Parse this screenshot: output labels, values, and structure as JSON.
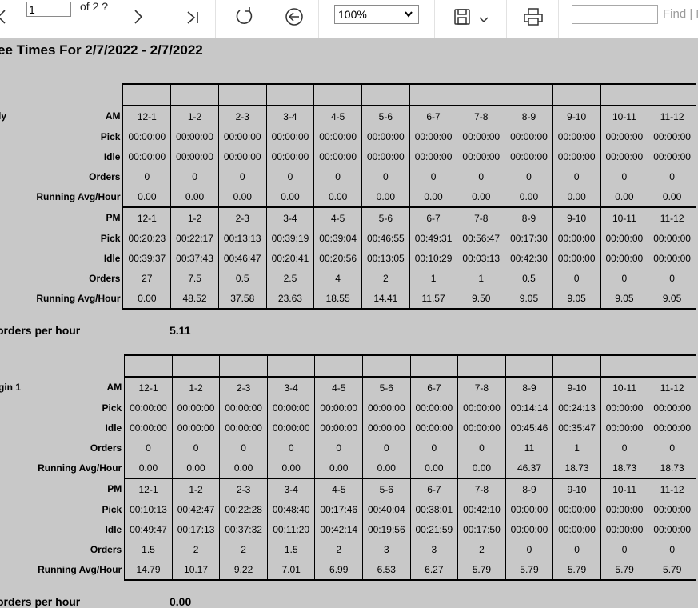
{
  "toolbar": {
    "page_value": "1",
    "page_of": "of 2 ?",
    "zoom": "100%",
    "find_value": "",
    "find_label": "Find | N"
  },
  "report": {
    "title": "ee Times For 2/7/2022 - 2/7/2022",
    "hours": [
      "12-1",
      "1-2",
      "2-3",
      "3-4",
      "4-5",
      "5-6",
      "6-7",
      "7-8",
      "8-9",
      "9-10",
      "10-11",
      "11-12"
    ],
    "row_labels": {
      "am": "AM",
      "pm": "PM",
      "pick": "Pick",
      "idle": "Idle",
      "orders": "Orders",
      "running": "Running Avg/Hour"
    },
    "sections": [
      {
        "name": "ly",
        "am": {
          "pick": [
            "00:00:00",
            "00:00:00",
            "00:00:00",
            "00:00:00",
            "00:00:00",
            "00:00:00",
            "00:00:00",
            "00:00:00",
            "00:00:00",
            "00:00:00",
            "00:00:00",
            "00:00:00"
          ],
          "idle": [
            "00:00:00",
            "00:00:00",
            "00:00:00",
            "00:00:00",
            "00:00:00",
            "00:00:00",
            "00:00:00",
            "00:00:00",
            "00:00:00",
            "00:00:00",
            "00:00:00",
            "00:00:00"
          ],
          "orders": [
            "0",
            "0",
            "0",
            "0",
            "0",
            "0",
            "0",
            "0",
            "0",
            "0",
            "0",
            "0"
          ],
          "running": [
            "0.00",
            "0.00",
            "0.00",
            "0.00",
            "0.00",
            "0.00",
            "0.00",
            "0.00",
            "0.00",
            "0.00",
            "0.00",
            "0.00"
          ]
        },
        "pm": {
          "pick": [
            "00:20:23",
            "00:22:17",
            "00:13:13",
            "00:39:19",
            "00:39:04",
            "00:46:55",
            "00:49:31",
            "00:56:47",
            "00:17:30",
            "00:00:00",
            "00:00:00",
            "00:00:00"
          ],
          "idle": [
            "00:39:37",
            "00:37:43",
            "00:46:47",
            "00:20:41",
            "00:20:56",
            "00:13:05",
            "00:10:29",
            "00:03:13",
            "00:42:30",
            "00:00:00",
            "00:00:00",
            "00:00:00"
          ],
          "orders": [
            "27",
            "7.5",
            "0.5",
            "2.5",
            "4",
            "2",
            "1",
            "1",
            "0.5",
            "0",
            "0",
            "0"
          ],
          "running": [
            "0.00",
            "48.52",
            "37.58",
            "23.63",
            "18.55",
            "14.41",
            "11.57",
            "9.50",
            "9.05",
            "9.05",
            "9.05",
            "9.05"
          ]
        },
        "summary_label": "orders per hour",
        "summary_value": "5.11"
      },
      {
        "name": "gin 1",
        "am": {
          "pick": [
            "00:00:00",
            "00:00:00",
            "00:00:00",
            "00:00:00",
            "00:00:00",
            "00:00:00",
            "00:00:00",
            "00:00:00",
            "00:14:14",
            "00:24:13",
            "00:00:00",
            "00:00:00"
          ],
          "idle": [
            "00:00:00",
            "00:00:00",
            "00:00:00",
            "00:00:00",
            "00:00:00",
            "00:00:00",
            "00:00:00",
            "00:00:00",
            "00:45:46",
            "00:35:47",
            "00:00:00",
            "00:00:00"
          ],
          "orders": [
            "0",
            "0",
            "0",
            "0",
            "0",
            "0",
            "0",
            "0",
            "11",
            "1",
            "0",
            "0"
          ],
          "running": [
            "0.00",
            "0.00",
            "0.00",
            "0.00",
            "0.00",
            "0.00",
            "0.00",
            "0.00",
            "46.37",
            "18.73",
            "18.73",
            "18.73"
          ]
        },
        "pm": {
          "pick": [
            "00:10:13",
            "00:42:47",
            "00:22:28",
            "00:48:40",
            "00:17:46",
            "00:40:04",
            "00:38:01",
            "00:42:10",
            "00:00:00",
            "00:00:00",
            "00:00:00",
            "00:00:00"
          ],
          "idle": [
            "00:49:47",
            "00:17:13",
            "00:37:32",
            "00:11:20",
            "00:42:14",
            "00:19:56",
            "00:21:59",
            "00:17:50",
            "00:00:00",
            "00:00:00",
            "00:00:00",
            "00:00:00"
          ],
          "orders": [
            "1.5",
            "2",
            "2",
            "1.5",
            "2",
            "3",
            "3",
            "2",
            "0",
            "0",
            "0",
            "0"
          ],
          "running": [
            "14.79",
            "10.17",
            "9.22",
            "7.01",
            "6.99",
            "6.53",
            "6.27",
            "5.79",
            "5.79",
            "5.79",
            "5.79",
            "5.79"
          ]
        },
        "summary_label": "orders per hour",
        "summary_value": "0.00"
      }
    ]
  }
}
